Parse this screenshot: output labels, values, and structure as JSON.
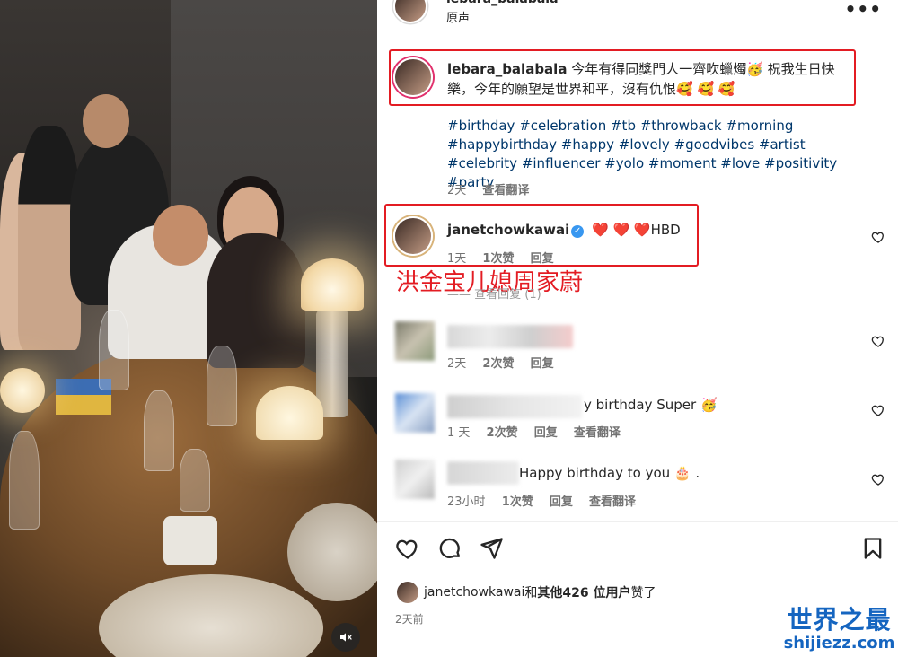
{
  "header": {
    "username": "lebara_balabala",
    "subtitle": "原声",
    "more_label": "•••"
  },
  "caption": {
    "username": "lebara_balabala",
    "text": "今年有得同獎門人一齊吹蠟燭🥳 祝我生日快樂，今年的願望是世界和平，沒有仇恨🥰 🥰 🥰",
    "hashtags": "#birthday #celebration #tb #throwback #morning #happybirthday #happy #lovely #goodvibes #artist #celebrity #influencer #yolo #moment #love #positivity #party",
    "time": "2天",
    "translate": "查看翻译"
  },
  "comments": [
    {
      "username": "janetchowkawai",
      "verified": true,
      "hearts": "❤️ ❤️ ❤️",
      "text": "HBD",
      "time": "1天",
      "likes": "1次赞",
      "reply": "回复"
    },
    {
      "username": "",
      "text": "",
      "time": "2天",
      "likes": "2次赞",
      "reply": "回复"
    },
    {
      "username": "",
      "text": "y birthday Super 🥳",
      "time": "1 天",
      "likes": "2次赞",
      "reply": "回复",
      "translate": "查看翻译"
    },
    {
      "username": "",
      "text": "Happy birthday to you 🎂 .",
      "time": "23小时",
      "likes": "1次赞",
      "reply": "回复",
      "translate": "查看翻译"
    }
  ],
  "annotation": "洪金宝儿媳周家蔚",
  "hidden_replies": "—— 查看回复 (1)",
  "actions": {
    "like": "heart-icon",
    "comment": "comment-icon",
    "share": "share-icon",
    "save": "bookmark-icon"
  },
  "liked_by": {
    "user": "janetchowkawai",
    "middle": "和",
    "others": "其他426 位用户",
    "suffix": "赞了"
  },
  "post_date": "2天前",
  "watermark": {
    "line1": "世界之最",
    "line2": "shijiezz.com"
  },
  "colors": {
    "annotation_red": "#e31c23",
    "link_blue": "#00376b",
    "watermark_blue": "#1565c0"
  }
}
